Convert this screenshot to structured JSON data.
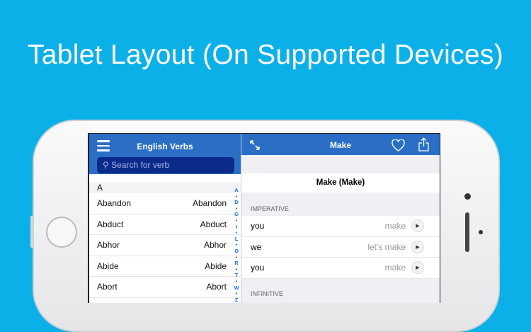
{
  "headline": "Tablet Layout (On Supported Devices)",
  "left": {
    "title": "English Verbs",
    "search_placeholder": "Search for verb",
    "section": "A",
    "rows": [
      {
        "a": "Abandon",
        "b": "Abandon"
      },
      {
        "a": "Abduct",
        "b": "Abduct"
      },
      {
        "a": "Abhor",
        "b": "Abhor"
      },
      {
        "a": "Abide",
        "b": "Abide"
      },
      {
        "a": "Abort",
        "b": "Abort"
      }
    ],
    "index": [
      "A",
      "•",
      "D",
      "•",
      "G",
      "•",
      "I",
      "•",
      "L",
      "•",
      "O",
      "•",
      "R",
      "•",
      "T",
      "•",
      "W",
      "•",
      "Z"
    ]
  },
  "right": {
    "title": "Make",
    "verb_heading": "Make (Make)",
    "section1": "IMPERATIVE",
    "rows": [
      {
        "p": "you",
        "v": "make"
      },
      {
        "p": "we",
        "v": "let's make"
      },
      {
        "p": "you",
        "v": "make"
      }
    ],
    "section2": "INFINITIVE"
  },
  "colors": {
    "background": "#0cb0e8",
    "nav": "#2a6ec6",
    "search": "#0b2a8a"
  }
}
